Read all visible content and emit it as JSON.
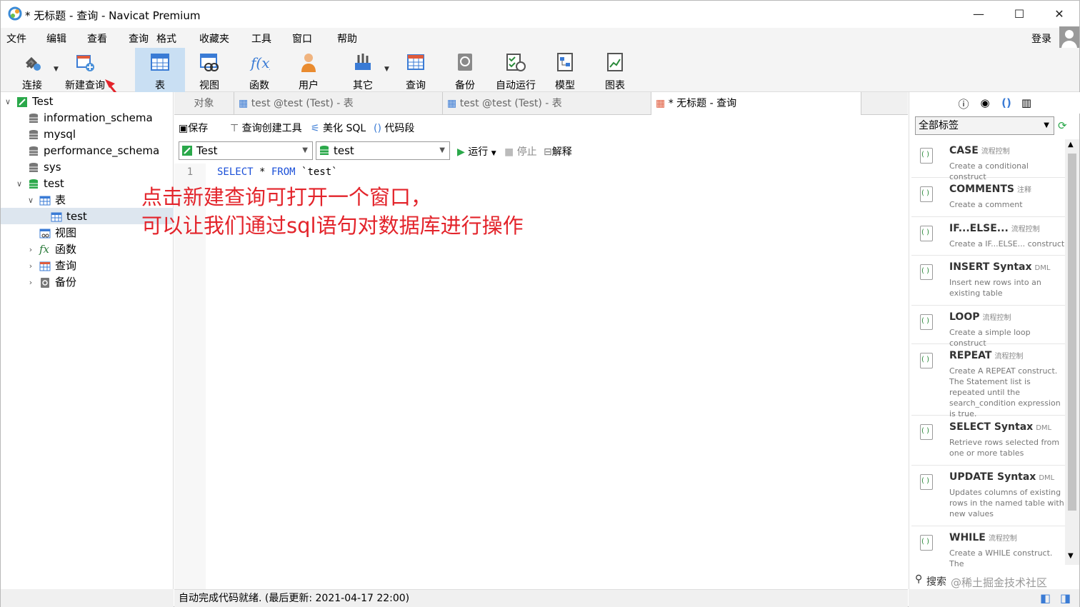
{
  "window": {
    "title": "* 无标题 - 查询 - Navicat Premium",
    "minimize_icon": "minimize-icon",
    "maximize_icon": "maximize-icon",
    "close_icon": "close-icon"
  },
  "menu": {
    "items": [
      "文件",
      "编辑",
      "查看",
      "查询",
      "格式",
      "收藏夹",
      "工具",
      "窗口",
      "帮助"
    ],
    "login": "登录"
  },
  "toolbar": {
    "items": [
      "连接",
      "新建查询",
      "表",
      "视图",
      "函数",
      "用户",
      "其它",
      "查询",
      "备份",
      "自动运行",
      "模型",
      "图表"
    ]
  },
  "tree": {
    "root": "Test",
    "dbs": [
      "information_schema",
      "mysql",
      "performance_schema",
      "sys",
      "test"
    ],
    "table_group": "表",
    "table": "test",
    "view_group": "视图",
    "func_group": "函数",
    "query_group": "查询",
    "backup_group": "备份"
  },
  "tabs": [
    "对象",
    "test @test (Test) - 表",
    "test @test (Test) - 表",
    "* 无标题 - 查询"
  ],
  "editor_toolbar": {
    "save": "保存",
    "builder": "查询创建工具",
    "beautify": "美化 SQL",
    "snippet": "代码段",
    "run": "运行",
    "stop": "停止",
    "explain": "解释"
  },
  "selectors": {
    "connection": "Test",
    "database": "test"
  },
  "editor": {
    "line": "1",
    "kw1": "SELECT",
    "star": " * ",
    "kw2": "FROM",
    "rest": " `test`"
  },
  "annotation": {
    "line1": "点击新建查询可打开一个窗口，",
    "line2": "可以让我们通过sql语句对数据库进行操作"
  },
  "right_panel": {
    "tag_select": "全部标签",
    "search": "搜索",
    "watermark": "@稀土掘金技术社区",
    "snippets": [
      {
        "title": "CASE",
        "tag": "流程控制",
        "desc": "Create a conditional construct"
      },
      {
        "title": "COMMENTS",
        "tag": "注释",
        "desc": "Create a comment"
      },
      {
        "title": "IF...ELSE...",
        "tag": "流程控制",
        "desc": "Create a IF...ELSE... construct"
      },
      {
        "title": "INSERT Syntax",
        "tag": "DML",
        "desc": "Insert new rows into an existing table"
      },
      {
        "title": "LOOP",
        "tag": "流程控制",
        "desc": "Create a simple loop construct"
      },
      {
        "title": "REPEAT",
        "tag": "流程控制",
        "desc": "Create A REPEAT construct. The Statement list is repeated until the search_condition expression is true."
      },
      {
        "title": "SELECT Syntax",
        "tag": "DML",
        "desc": "Retrieve rows selected from one or more tables"
      },
      {
        "title": "UPDATE Syntax",
        "tag": "DML",
        "desc": "Updates columns of existing rows in the named table with new values"
      },
      {
        "title": "WHILE",
        "tag": "流程控制",
        "desc": "Create a WHILE construct. The"
      }
    ]
  },
  "status": {
    "text": "自动完成代码就绪. (最后更新: 2021-04-17 22:00)"
  },
  "colors": {
    "accent": "#1a4fd8",
    "annotation": "#e3242b",
    "selected_tool": "#c9dff3"
  }
}
